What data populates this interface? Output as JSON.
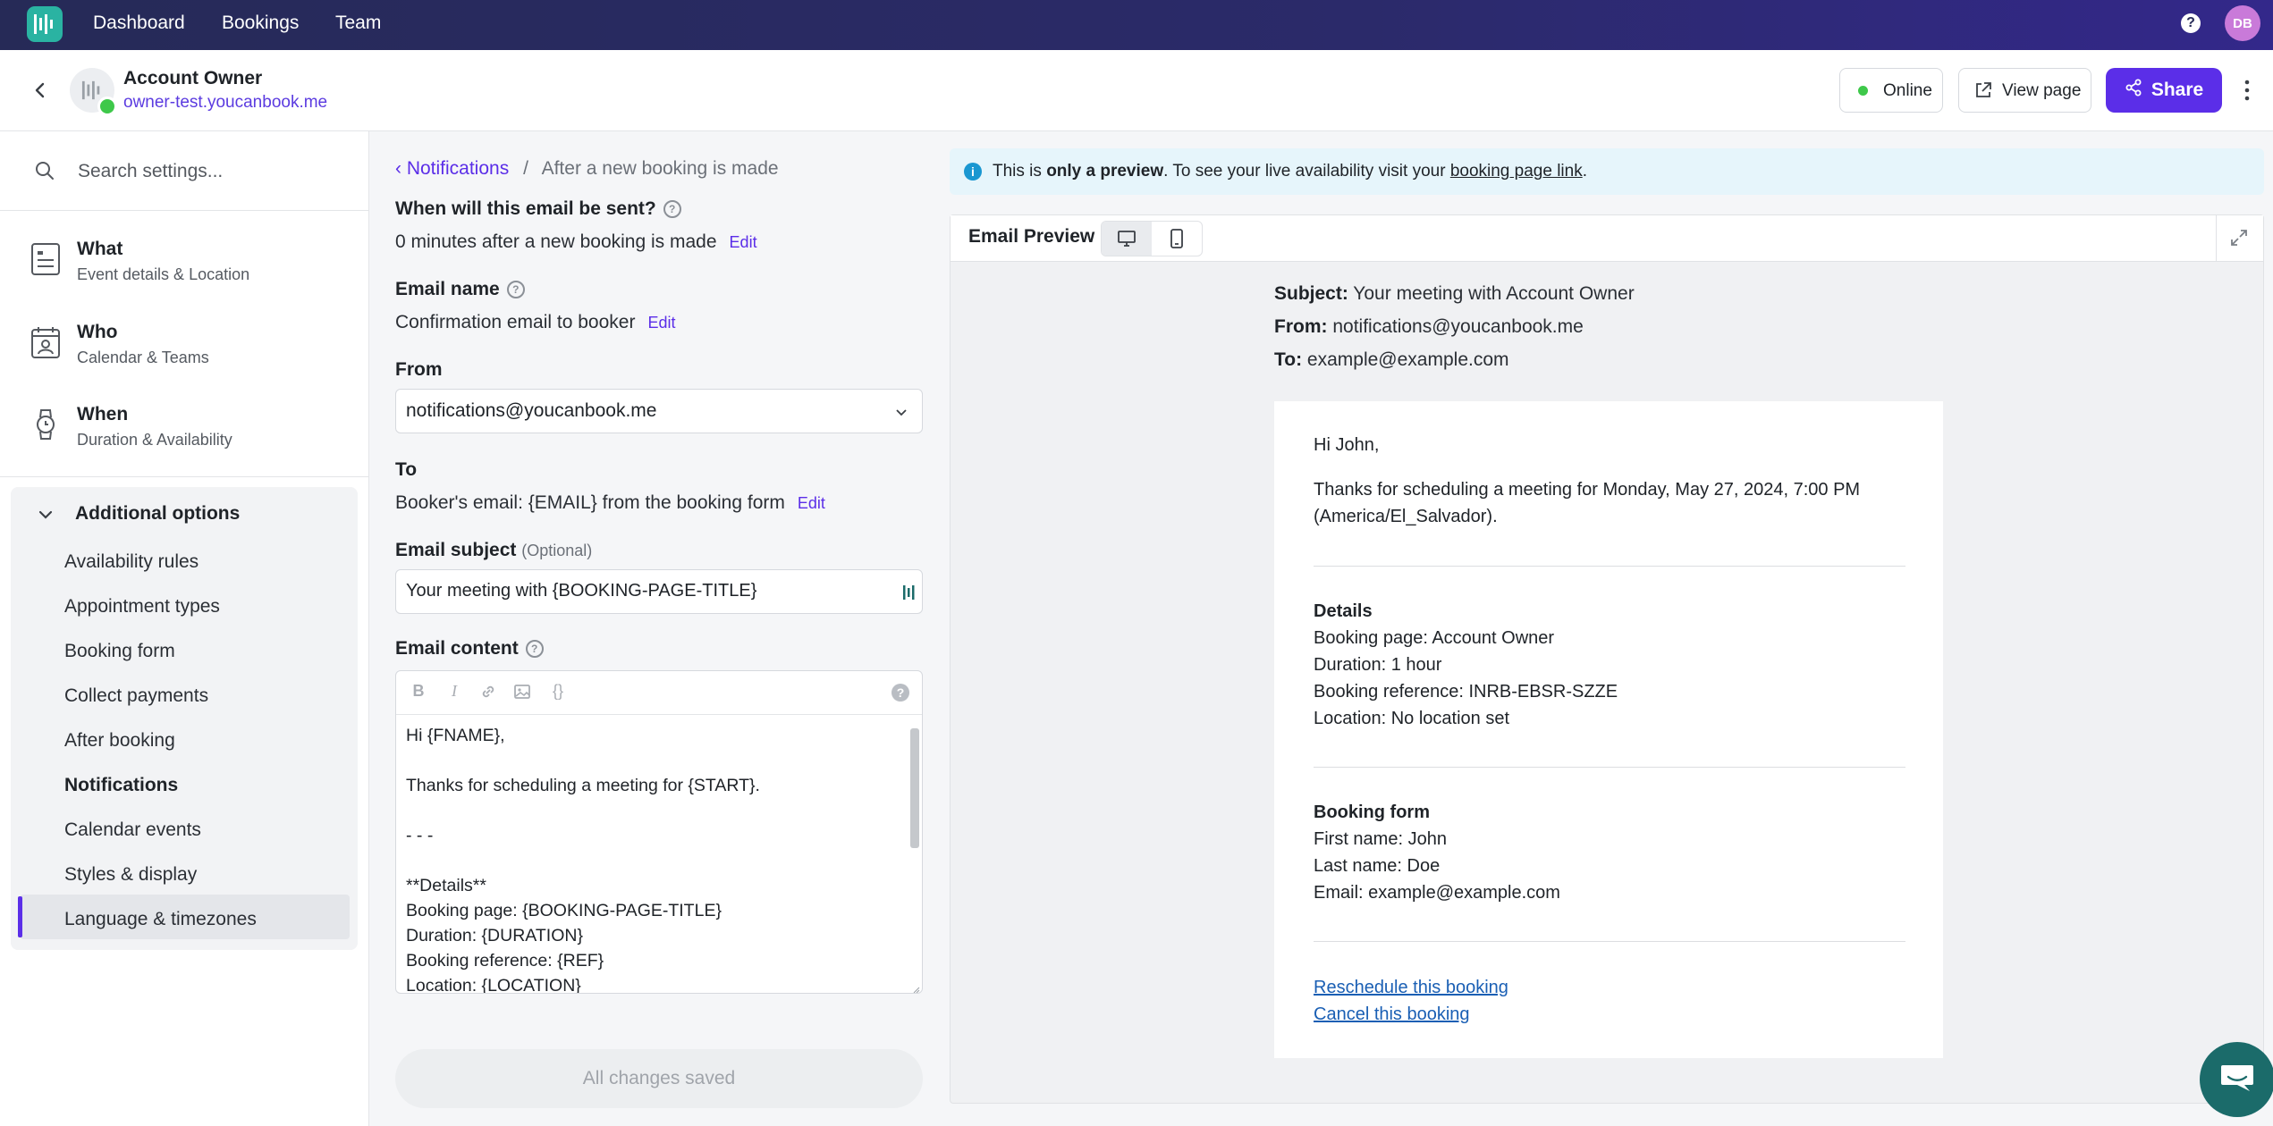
{
  "topnav": {
    "links": [
      "Dashboard",
      "Bookings",
      "Team"
    ],
    "help_icon": "?",
    "avatar_initials": "DB"
  },
  "account": {
    "name": "Account Owner",
    "url": "owner-test.youcanbook.me",
    "status": "Online",
    "view_page": "View page",
    "share": "Share",
    "status_color": "#3ec84a"
  },
  "sidebar": {
    "search_placeholder": "Search settings...",
    "main_items": [
      {
        "title": "What",
        "subtitle": "Event details & Location",
        "icon": "list-form-icon"
      },
      {
        "title": "Who",
        "subtitle": "Calendar & Teams",
        "icon": "calendar-person-icon"
      },
      {
        "title": "When",
        "subtitle": "Duration & Availability",
        "icon": "watch-icon"
      }
    ],
    "additional": {
      "title": "Additional options",
      "items": [
        "Availability rules",
        "Appointment types",
        "Booking form",
        "Collect payments",
        "After booking",
        "Notifications",
        "Calendar events",
        "Styles & display",
        "Language & timezones"
      ],
      "active": "Notifications"
    }
  },
  "form": {
    "breadcrumb_parent": "Notifications",
    "breadcrumb_current": "After a new booking is made",
    "when_label": "When will this email be sent?",
    "when_value": "0 minutes after a new booking is made",
    "edit": "Edit",
    "email_name_label": "Email name",
    "email_name_value": "Confirmation email to booker",
    "from_label": "From",
    "from_value": "notifications@youcanbook.me",
    "to_label": "To",
    "to_value": "Booker's email: {EMAIL} from the booking form",
    "subject_label": "Email subject",
    "subject_optional": "(Optional)",
    "subject_value": "Your meeting with {BOOKING-PAGE-TITLE}",
    "content_label": "Email content",
    "toolbar_help": "?",
    "content_body": "Hi {FNAME},\n\nThanks for scheduling a meeting for {START}.\n\n- - -\n\n**Details**\nBooking page: {BOOKING-PAGE-TITLE}\nDuration: {DURATION}\nBooking reference: {REF}\nLocation: {LOCATION}",
    "saved_label": "All changes saved"
  },
  "preview": {
    "info_prefix": "This is ",
    "info_bold": "only a preview",
    "info_mid": ". To see your live availability visit your ",
    "info_link": "booking page link",
    "info_suffix": ".",
    "title": "Email Preview",
    "subject_key": "Subject:",
    "subject_val": " Your meeting with Account Owner",
    "from_key": "From:",
    "from_val": " notifications@youcanbook.me",
    "to_key": "To:",
    "to_val": " example@example.com",
    "greeting": "Hi John,",
    "thanks_1": "Thanks for scheduling a meeting for Monday, May 27, 2024, 7:00 PM",
    "thanks_2": "(America/El_Salvador).",
    "details_title": "Details",
    "details": [
      "Booking page: Account Owner",
      "Duration: 1 hour",
      "Booking reference: INRB-EBSR-SZZE",
      "Location: No location set"
    ],
    "form_title": "Booking form",
    "form_lines": [
      "First name: John",
      "Last name: Doe",
      "Email: example@example.com"
    ],
    "reschedule": "Reschedule this booking",
    "cancel": "Cancel this booking"
  },
  "colors": {
    "accent": "#5b2ee8",
    "nav_bg": "#262a57",
    "logo": "#2ab3a2",
    "chat": "#1b6b6a"
  }
}
